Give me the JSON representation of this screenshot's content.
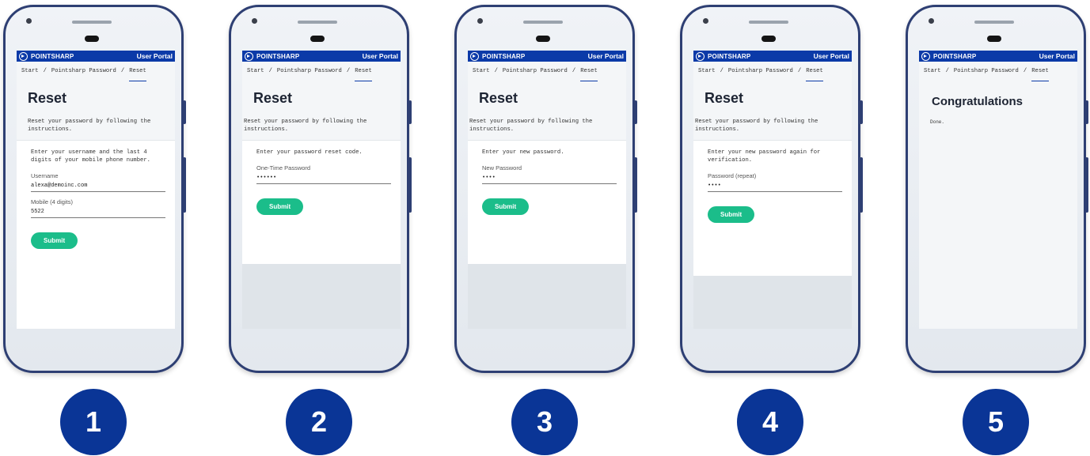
{
  "app": {
    "brand": "POINTSHARP",
    "portal": "User Portal"
  },
  "breadcrumb": [
    "Start",
    "Pointsharp Password",
    "Reset"
  ],
  "reset_title": "Reset",
  "reset_desc": "Reset your password by following the instructions.",
  "submit_label": "Submit",
  "steps": [
    {
      "number": "1",
      "instruction": "Enter your username and the last 4 digits of your mobile phone number.",
      "fields": [
        {
          "label": "Username",
          "value": "alexa@demoinc.com"
        },
        {
          "label": "Mobile (4 digits)",
          "value": "5522"
        }
      ]
    },
    {
      "number": "2",
      "instruction": "Enter your password reset code.",
      "fields": [
        {
          "label": "One-Time Password",
          "value": "••••••"
        }
      ]
    },
    {
      "number": "3",
      "instruction": "Enter your new password.",
      "fields": [
        {
          "label": "New Password",
          "value": "••••"
        }
      ]
    },
    {
      "number": "4",
      "instruction": "Enter your new password again for verification.",
      "fields": [
        {
          "label": "Password (repeat)",
          "value": "••••"
        }
      ]
    },
    {
      "number": "5",
      "title": "Congratulations",
      "message": "Done."
    }
  ]
}
